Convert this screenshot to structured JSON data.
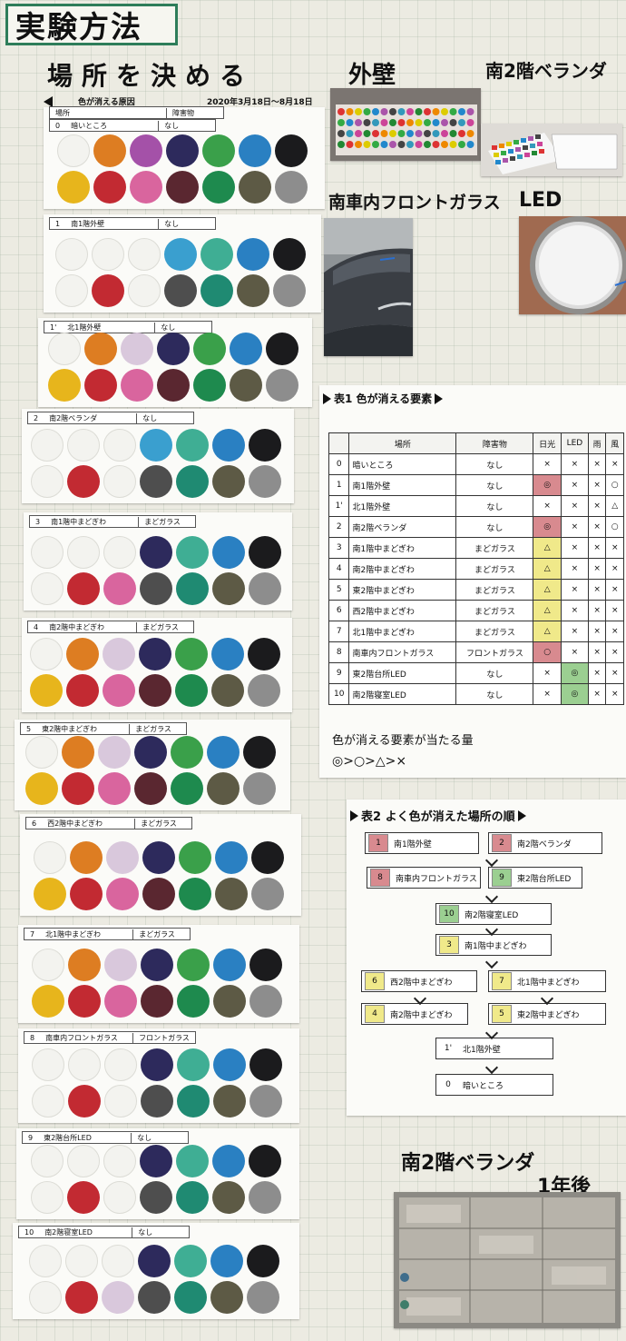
{
  "title": "実験方法",
  "heading": {
    "place_label": "場所を決める",
    "wall": "外壁",
    "veranda": "南2階ベランダ"
  },
  "sample_sheet": {
    "caption": "色が消える原因",
    "date": "2020年3月18日〜8月18日",
    "col_place": "場所",
    "col_obstacle": "障害物"
  },
  "photo_labels": {
    "windshield": "南車内フロントガラス",
    "led": "LED"
  },
  "samples": [
    {
      "num": "0",
      "place": "暗いところ",
      "obstacle": "なし",
      "top": [
        "e",
        "orange",
        "purple",
        "navy",
        "green",
        "blue",
        "black"
      ],
      "bottom": [
        "yellow",
        "red",
        "pink",
        "maroon",
        "dgreen",
        "olive",
        "gray"
      ]
    },
    {
      "num": "1",
      "place": "南1階外壁",
      "obstacle": "なし",
      "top": [
        "e",
        "e",
        "e",
        "lblue",
        "teal",
        "blue",
        "black"
      ],
      "bottom": [
        "e",
        "red",
        "e",
        "dgray",
        "dteal",
        "olive",
        "gray"
      ]
    },
    {
      "num": "1'",
      "place": "北1階外壁",
      "obstacle": "なし",
      "top": [
        "e",
        "orange",
        "lpurple",
        "navy",
        "green",
        "blue",
        "black"
      ],
      "bottom": [
        "yellow",
        "red",
        "pink",
        "maroon",
        "dgreen",
        "olive",
        "gray"
      ]
    },
    {
      "num": "2",
      "place": "南2階ベランダ",
      "obstacle": "なし",
      "top": [
        "e",
        "e",
        "e",
        "lblue",
        "teal",
        "blue",
        "black"
      ],
      "bottom": [
        "e",
        "red",
        "e",
        "dgray",
        "dteal",
        "olive",
        "gray"
      ]
    },
    {
      "num": "3",
      "place": "南1階中まどぎわ",
      "obstacle": "まどガラス",
      "top": [
        "e",
        "e",
        "e",
        "navy",
        "teal",
        "blue",
        "black"
      ],
      "bottom": [
        "e",
        "red",
        "pink",
        "dgray",
        "dteal",
        "olive",
        "gray"
      ]
    },
    {
      "num": "4",
      "place": "南2階中まどぎわ",
      "obstacle": "まどガラス",
      "top": [
        "e",
        "orange",
        "lpurple",
        "navy",
        "green",
        "blue",
        "black"
      ],
      "bottom": [
        "yellow",
        "red",
        "pink",
        "maroon",
        "dgreen",
        "olive",
        "gray"
      ]
    },
    {
      "num": "5",
      "place": "東2階中まどぎわ",
      "obstacle": "まどガラス",
      "top": [
        "e",
        "orange",
        "lpurple",
        "navy",
        "green",
        "blue",
        "black"
      ],
      "bottom": [
        "yellow",
        "red",
        "pink",
        "maroon",
        "dgreen",
        "olive",
        "gray"
      ]
    },
    {
      "num": "6",
      "place": "西2階中まどぎわ",
      "obstacle": "まどガラス",
      "top": [
        "e",
        "orange",
        "lpurple",
        "navy",
        "green",
        "blue",
        "black"
      ],
      "bottom": [
        "yellow",
        "red",
        "pink",
        "maroon",
        "dgreen",
        "olive",
        "gray"
      ]
    },
    {
      "num": "7",
      "place": "北1階中まどぎわ",
      "obstacle": "まどガラス",
      "top": [
        "e",
        "orange",
        "lpurple",
        "navy",
        "green",
        "blue",
        "black"
      ],
      "bottom": [
        "yellow",
        "red",
        "pink",
        "maroon",
        "dgreen",
        "olive",
        "gray"
      ]
    },
    {
      "num": "8",
      "place": "南車内フロントガラス",
      "obstacle": "フロントガラス",
      "top": [
        "e",
        "e",
        "e",
        "navy",
        "teal",
        "blue",
        "black"
      ],
      "bottom": [
        "e",
        "red",
        "e",
        "dgray",
        "dteal",
        "olive",
        "gray"
      ]
    },
    {
      "num": "9",
      "place": "東2階台所LED",
      "obstacle": "なし",
      "top": [
        "e",
        "e",
        "e",
        "navy",
        "teal",
        "blue",
        "black"
      ],
      "bottom": [
        "e",
        "red",
        "e",
        "dgray",
        "dteal",
        "olive",
        "gray"
      ]
    },
    {
      "num": "10",
      "place": "南2階寝室LED",
      "obstacle": "なし",
      "top": [
        "e",
        "e",
        "e",
        "navy",
        "teal",
        "blue",
        "black"
      ],
      "bottom": [
        "e",
        "red",
        "lpurple",
        "dgray",
        "dteal",
        "olive",
        "gray"
      ]
    }
  ],
  "palette": {
    "orange": "#dd7d22",
    "purple": "#a451a8",
    "lpurple": "#d9c8dc",
    "navy": "#2d2a5c",
    "green": "#3aa04a",
    "blue": "#2a80c2",
    "black": "#1b1b1d",
    "yellow": "#e7b51c",
    "red": "#c22a32",
    "pink": "#d9659e",
    "maroon": "#5a2730",
    "dgreen": "#1e8a4e",
    "olive": "#5d5a45",
    "gray": "#8d8d8d",
    "lblue": "#3a9fcf",
    "teal": "#3fae94",
    "dteal": "#1f8a72",
    "dgray": "#4e4e4e"
  },
  "table1": {
    "title": "表1 色が消える要素",
    "headers": [
      "",
      "場所",
      "障害物",
      "日光",
      "LED",
      "雨",
      "風"
    ],
    "rows": [
      {
        "num": "0",
        "place": "暗いところ",
        "obstacle": "なし",
        "sun": "×",
        "led": "×",
        "rain": "×",
        "wind": "×",
        "sun_c": "",
        "led_c": ""
      },
      {
        "num": "1",
        "place": "南1階外壁",
        "obstacle": "なし",
        "sun": "◎",
        "led": "×",
        "rain": "×",
        "wind": "○",
        "sun_c": "red",
        "led_c": ""
      },
      {
        "num": "1'",
        "place": "北1階外壁",
        "obstacle": "なし",
        "sun": "×",
        "led": "×",
        "rain": "×",
        "wind": "△",
        "sun_c": "",
        "led_c": ""
      },
      {
        "num": "2",
        "place": "南2階ベランダ",
        "obstacle": "なし",
        "sun": "◎",
        "led": "×",
        "rain": "×",
        "wind": "○",
        "sun_c": "red",
        "led_c": ""
      },
      {
        "num": "3",
        "place": "南1階中まどぎわ",
        "obstacle": "まどガラス",
        "sun": "△",
        "led": "×",
        "rain": "×",
        "wind": "×",
        "sun_c": "yel",
        "led_c": ""
      },
      {
        "num": "4",
        "place": "南2階中まどぎわ",
        "obstacle": "まどガラス",
        "sun": "△",
        "led": "×",
        "rain": "×",
        "wind": "×",
        "sun_c": "yel",
        "led_c": ""
      },
      {
        "num": "5",
        "place": "東2階中まどぎわ",
        "obstacle": "まどガラス",
        "sun": "△",
        "led": "×",
        "rain": "×",
        "wind": "×",
        "sun_c": "yel",
        "led_c": ""
      },
      {
        "num": "6",
        "place": "西2階中まどぎわ",
        "obstacle": "まどガラス",
        "sun": "△",
        "led": "×",
        "rain": "×",
        "wind": "×",
        "sun_c": "yel",
        "led_c": ""
      },
      {
        "num": "7",
        "place": "北1階中まどぎわ",
        "obstacle": "まどガラス",
        "sun": "△",
        "led": "×",
        "rain": "×",
        "wind": "×",
        "sun_c": "yel",
        "led_c": ""
      },
      {
        "num": "8",
        "place": "南車内フロントガラス",
        "obstacle": "フロントガラス",
        "sun": "○",
        "led": "×",
        "rain": "×",
        "wind": "×",
        "sun_c": "red",
        "led_c": ""
      },
      {
        "num": "9",
        "place": "東2階台所LED",
        "obstacle": "なし",
        "sun": "×",
        "led": "◎",
        "rain": "×",
        "wind": "×",
        "sun_c": "",
        "led_c": "grn"
      },
      {
        "num": "10",
        "place": "南2階寝室LED",
        "obstacle": "なし",
        "sun": "×",
        "led": "◎",
        "rain": "×",
        "wind": "×",
        "sun_c": "",
        "led_c": "grn"
      }
    ],
    "note": "色が消える要素が当たる量",
    "scale": "◎>○>△>×"
  },
  "table2": {
    "title": "表2 よく色が消えた場所の順",
    "items": [
      {
        "num": "1",
        "place": "南1階外壁",
        "color": "red"
      },
      {
        "num": "2",
        "place": "南2階ベランダ",
        "color": "red"
      },
      {
        "num": "8",
        "place": "南車内フロントガラス",
        "color": "red"
      },
      {
        "num": "9",
        "place": "東2階台所LED",
        "color": "grn"
      },
      {
        "num": "10",
        "place": "南2階寝室LED",
        "color": "grn"
      },
      {
        "num": "3",
        "place": "南1階中まどぎわ",
        "color": "yel"
      },
      {
        "num": "6",
        "place": "西2階中まどぎわ",
        "color": "yel"
      },
      {
        "num": "7",
        "place": "北1階中まどぎわ",
        "color": "yel"
      },
      {
        "num": "4",
        "place": "南2階中まどぎわ",
        "color": "yel"
      },
      {
        "num": "5",
        "place": "東2階中まどぎわ",
        "color": "yel"
      },
      {
        "num": "1'",
        "place": "北1階外壁",
        "color": ""
      },
      {
        "num": "0",
        "place": "暗いところ",
        "color": ""
      }
    ]
  },
  "after_year": {
    "line1": "南2階ベランダ",
    "line2": "1年後"
  }
}
